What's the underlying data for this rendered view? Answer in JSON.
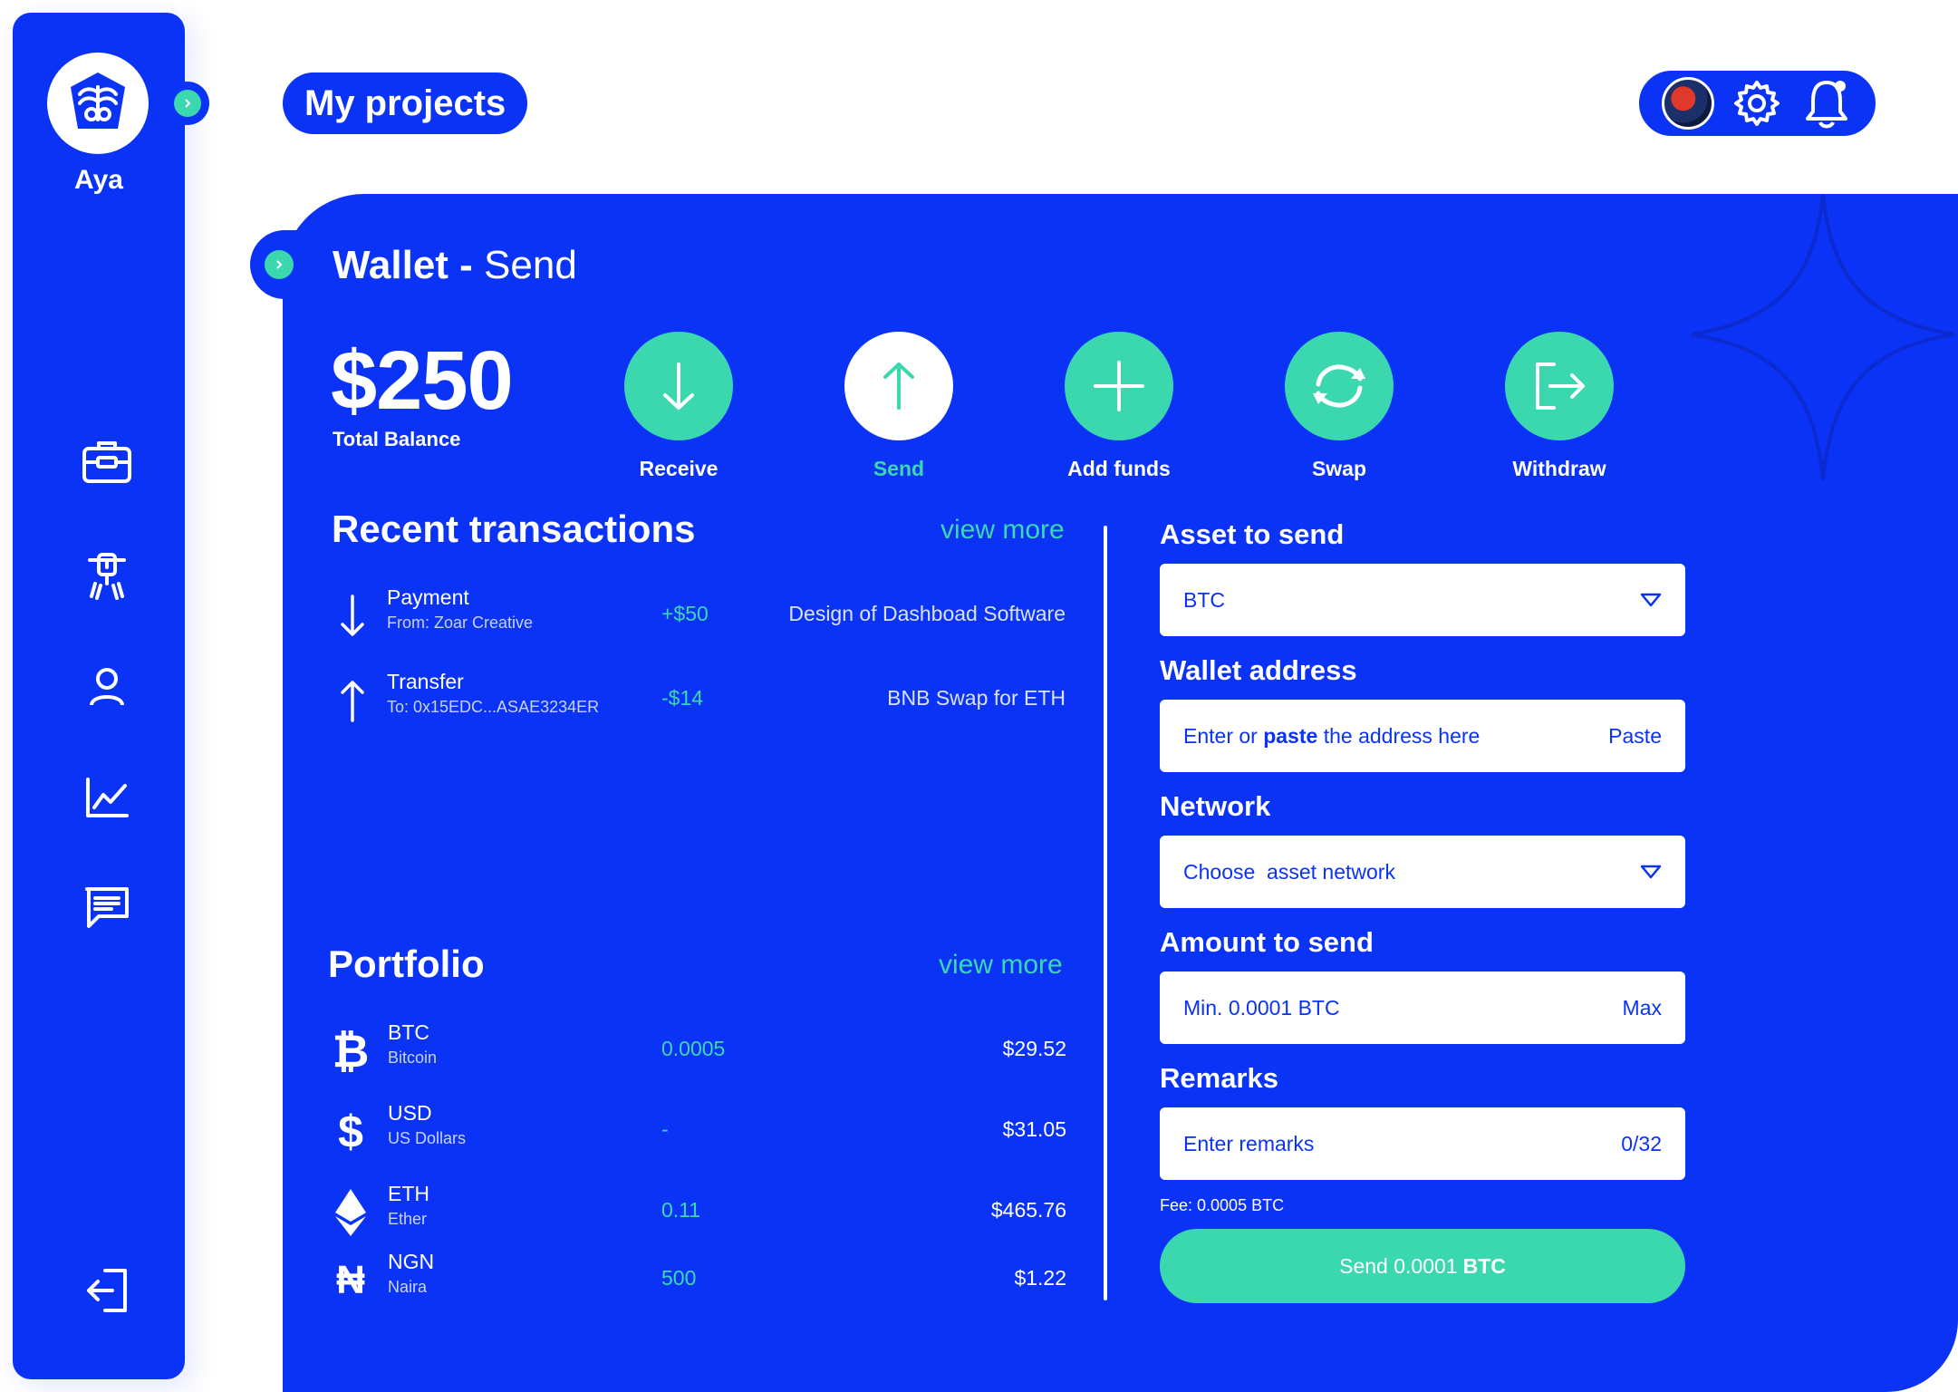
{
  "brand": {
    "name": "Aya",
    "accent": "#0a33f5",
    "secondary": "#3bd8b0"
  },
  "header": {
    "title": "My projects",
    "icons": [
      "avatar",
      "gear-icon",
      "bell-icon"
    ]
  },
  "sidebar": {
    "items": [
      {
        "icon": "briefcase-icon"
      },
      {
        "icon": "tools-icon"
      },
      {
        "icon": "user-icon"
      },
      {
        "icon": "chart-icon"
      },
      {
        "icon": "message-icon"
      }
    ],
    "logout_icon": "logout-icon"
  },
  "wallet": {
    "title_bold": "Wallet - ",
    "title_rest": "Send",
    "balance": "$250",
    "balance_label": "Total Balance"
  },
  "actions": [
    {
      "label": "Receive",
      "icon": "arrow-down-icon",
      "active": false
    },
    {
      "label": "Send",
      "icon": "arrow-up-icon",
      "active": true
    },
    {
      "label": "Add funds",
      "icon": "plus-icon",
      "active": false
    },
    {
      "label": "Swap",
      "icon": "swap-icon",
      "active": false
    },
    {
      "label": "Withdraw",
      "icon": "withdraw-icon",
      "active": false
    }
  ],
  "transactions": {
    "title": "Recent transactions",
    "view_more": "view more",
    "rows": [
      {
        "type": "Payment",
        "party": "From: Zoar Creative",
        "amount": "+$50",
        "description": "Design of Dashboad Software",
        "direction": "down"
      },
      {
        "type": "Transfer",
        "party": "To: 0x15EDC...ASAE3234ER",
        "amount": "-$14",
        "description": "BNB Swap for ETH",
        "direction": "up"
      }
    ]
  },
  "portfolio": {
    "title": "Portfolio",
    "view_more": "view more",
    "rows": [
      {
        "icon": "bitcoin-icon",
        "symbol": "BTC",
        "name": "Bitcoin",
        "qty": "0.0005",
        "value": "$29.52"
      },
      {
        "icon": "dollar-icon",
        "symbol": "USD",
        "name": "US Dollars",
        "qty": "-",
        "value": "$31.05"
      },
      {
        "icon": "ether-icon",
        "symbol": "ETH",
        "name": "Ether",
        "qty": "0.11",
        "value": "$465.76"
      },
      {
        "icon": "naira-icon",
        "symbol": "NGN",
        "name": "Naira",
        "qty": "500",
        "value": "$1.22"
      }
    ]
  },
  "form": {
    "asset_label": "Asset to send",
    "asset_value": "BTC",
    "address_label": "Wallet address",
    "address_placeholder_a": "Enter or ",
    "address_placeholder_b": "paste",
    "address_placeholder_c": " the address here",
    "address_action": "Paste",
    "network_label": "Network",
    "network_placeholder": "Choose  asset network",
    "amount_label": "Amount to send",
    "amount_placeholder": "Min. 0.0001 BTC",
    "amount_action": "Max",
    "remarks_label": "Remarks",
    "remarks_placeholder": "Enter remarks",
    "remarks_counter": "0/32",
    "fee": "Fee: 0.0005 BTC",
    "send_prefix": "Send 0.0001",
    "send_unit": "BTC"
  }
}
